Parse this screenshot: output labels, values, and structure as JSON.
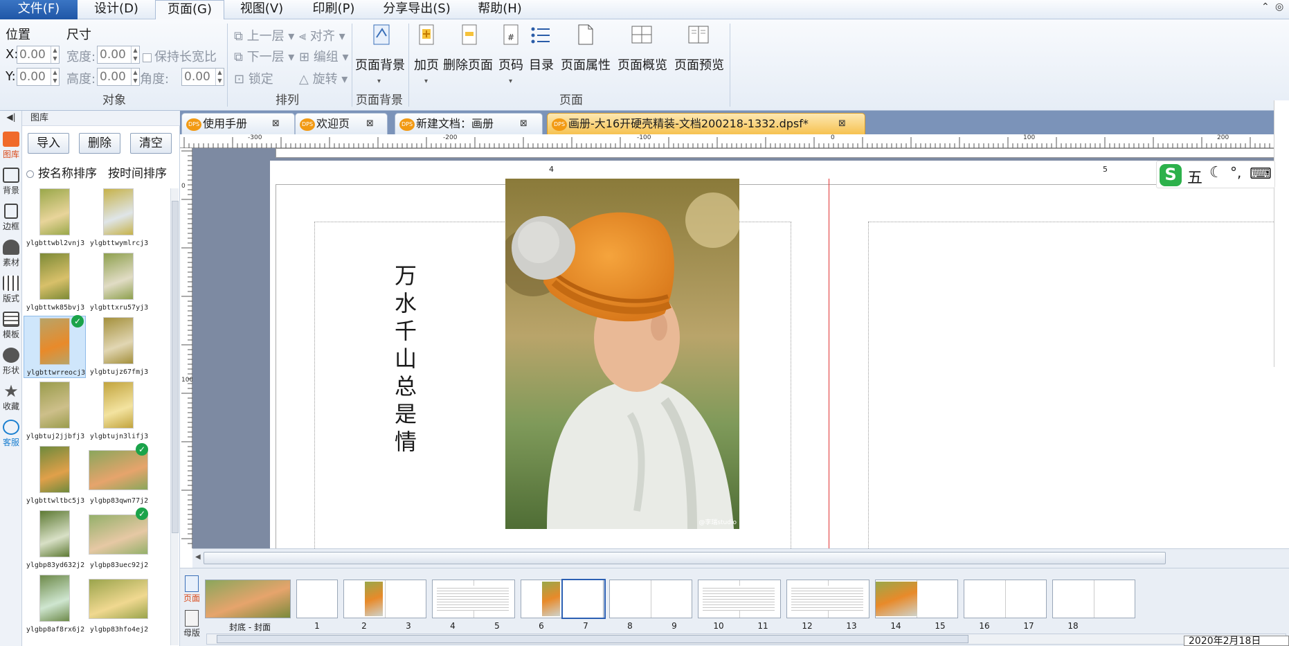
{
  "menu": {
    "items": [
      "文件(F)",
      "设计(D)",
      "页面(G)",
      "视图(V)",
      "印刷(P)",
      "分享导出(S)",
      "帮助(H)"
    ],
    "active_index": 2
  },
  "ribbon": {
    "position_label": "位置",
    "size_label": "尺寸",
    "x_label": "X:",
    "y_label": "Y:",
    "x_value": "0.00",
    "y_value": "0.00",
    "width_label": "宽度:",
    "height_label": "高度:",
    "angle_label": "角度:",
    "width_value": "0.00",
    "height_value": "0.00",
    "angle_value": "0.00",
    "keep_ratio": "保持长宽比",
    "group_object": "对象",
    "arrange": {
      "bring_up": "上一层",
      "send_down": "下一层",
      "lock": "锁定",
      "align": "对齐",
      "group": "编组",
      "rotate": "旋转"
    },
    "group_arrange": "排列",
    "page_bg_button": "页面背景",
    "group_page_bg": "页面背景",
    "page_buttons": [
      "加页",
      "删除页面",
      "页码",
      "目录",
      "页面属性",
      "页面概览",
      "页面预览"
    ],
    "group_page": "页面"
  },
  "leftbar": [
    "图库",
    "背景",
    "边框",
    "素材",
    "版式",
    "模板",
    "形状",
    "收藏",
    "客服"
  ],
  "library": {
    "title": "图库",
    "import": "导入",
    "delete": "删除",
    "clear": "清空",
    "sort_by_name": "按名称排序",
    "sort_by_time": "按时间排序",
    "items": [
      {
        "name": "ylgbttwbl2vnj3",
        "checked": false,
        "selected": false
      },
      {
        "name": "ylgbttwymlrcj3",
        "checked": false,
        "selected": false
      },
      {
        "name": "ylgbttwk85bvj3",
        "checked": false,
        "selected": false
      },
      {
        "name": "ylgbttxru57yj3",
        "checked": false,
        "selected": false
      },
      {
        "name": "ylgbttwrreocj3",
        "checked": true,
        "selected": true
      },
      {
        "name": "ylgbtujz67fmj3",
        "checked": false,
        "selected": false
      },
      {
        "name": "ylgbtuj2jjbfj3",
        "checked": false,
        "selected": false
      },
      {
        "name": "ylgbtujn3lifj3",
        "checked": false,
        "selected": false
      },
      {
        "name": "ylgbttwltbc5j3",
        "checked": false,
        "selected": false
      },
      {
        "name": "ylgbp83qwn77j2",
        "checked": true,
        "selected": false
      },
      {
        "name": "ylgbp83yd632j2",
        "checked": false,
        "selected": false
      },
      {
        "name": "ylgbp83uec92j2",
        "checked": true,
        "selected": false
      },
      {
        "name": "ylgbp8af8rx6j2",
        "checked": false,
        "selected": false
      },
      {
        "name": "ylgbp83hfo4ej2",
        "checked": false,
        "selected": false
      }
    ]
  },
  "tabs": [
    {
      "label": "使用手册",
      "active": false
    },
    {
      "label": "欢迎页",
      "active": false
    },
    {
      "label": "新建文档：画册",
      "active": false
    },
    {
      "label": "画册-大16开硬壳精装-文档200218-1332.dpsf*",
      "active": true
    }
  ],
  "tab_icon": "DPS",
  "ruler": {
    "h_labels": [
      "-300",
      "-200",
      "-100",
      "0",
      "100",
      "200"
    ],
    "v_labels": [
      "0",
      "100"
    ]
  },
  "canvas": {
    "left_page_number": "4",
    "right_page_number": "5",
    "vertical_text": "万水千山总是情",
    "watermark": "@李瑞studio"
  },
  "strip": {
    "page_tab": "页面",
    "master_tab": "母版",
    "cover_label": "封底 - 封面",
    "page_numbers": [
      "1",
      "2",
      "3",
      "4",
      "5",
      "6",
      "7",
      "8",
      "9",
      "10",
      "11",
      "12",
      "13",
      "14",
      "15",
      "16",
      "17",
      "18"
    ]
  },
  "ime": {
    "mode": "五"
  },
  "status": {
    "date": "2020年2月18日"
  }
}
